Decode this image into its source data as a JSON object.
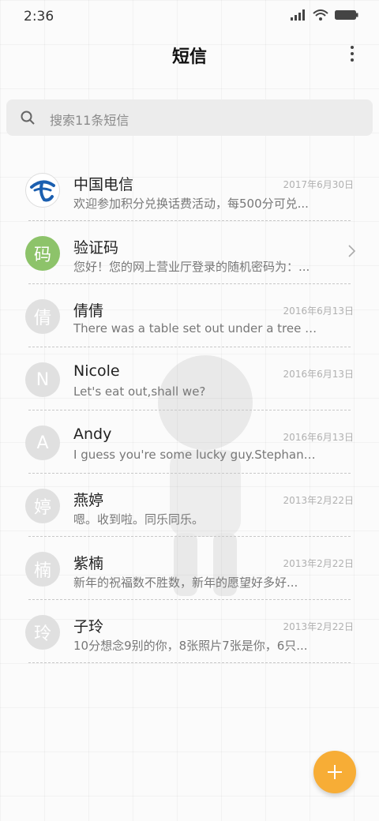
{
  "status_bar": {
    "time": "2:36"
  },
  "header": {
    "title": "短信"
  },
  "search": {
    "placeholder": "搜索11条短信"
  },
  "conversations": [
    {
      "name": "中国电信",
      "date": "2017年6月30日",
      "preview": "欢迎参加积分兑换话费活动，每500分可兑...",
      "avatar_type": "logo",
      "avatar_text": ""
    },
    {
      "name": "验证码",
      "date": "",
      "preview": "您好！您的网上营业厅登录的随机密码为：...",
      "avatar_type": "green",
      "avatar_text": "码"
    },
    {
      "name": "倩倩",
      "date": "2016年6月13日",
      "preview": "There was a table set out under a tree in...",
      "avatar_type": "grey",
      "avatar_text": "倩"
    },
    {
      "name": "Nicole",
      "date": "2016年6月13日",
      "preview": "Let's eat out,shall we?",
      "avatar_type": "grey",
      "avatar_text": "N"
    },
    {
      "name": "Andy",
      "date": "2016年6月13日",
      "preview": "I guess you're some lucky guy.Stephani...",
      "avatar_type": "grey",
      "avatar_text": "A"
    },
    {
      "name": "燕婷",
      "date": "2013年2月22日",
      "preview": "嗯。收到啦。同乐同乐。",
      "avatar_type": "grey",
      "avatar_text": "婷"
    },
    {
      "name": "紫楠",
      "date": "2013年2月22日",
      "preview": "新年的祝福数不胜数，新年的愿望好多好...",
      "avatar_type": "grey",
      "avatar_text": "楠"
    },
    {
      "name": "子玲",
      "date": "2013年2月22日",
      "preview": "10分想念9别的你，8张照片7张是你，6只...",
      "avatar_type": "grey",
      "avatar_text": "玲"
    }
  ],
  "colors": {
    "fab": "#f7ad36",
    "avatar_green": "#8dc36a",
    "avatar_grey": "#e0e0e0",
    "telecom_blue": "#1b5fb0"
  },
  "icons": {
    "signal": "signal-icon",
    "wifi": "wifi-icon",
    "battery": "battery-icon",
    "more": "more-vertical-icon",
    "search": "search-icon",
    "chevron": "chevron-right-icon",
    "fab": "plus-icon"
  }
}
